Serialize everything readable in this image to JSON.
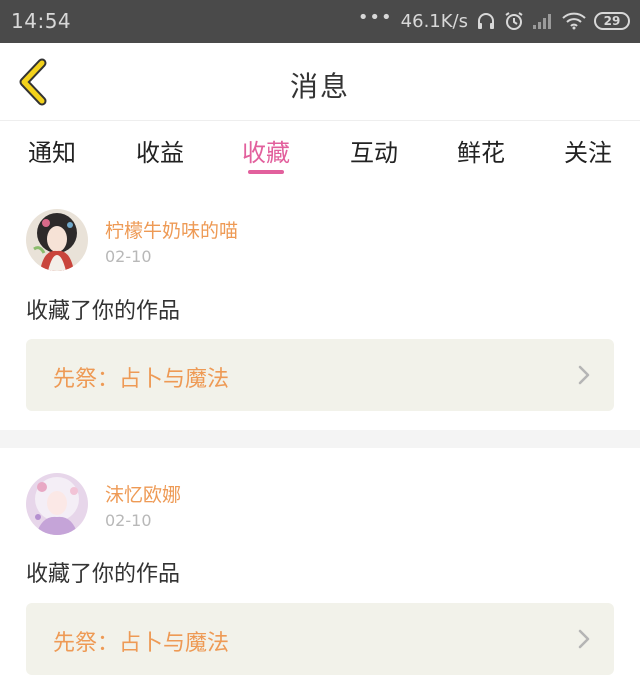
{
  "status_bar": {
    "time": "14:54",
    "dots": "•••",
    "network_speed": "46.1K/s",
    "battery_level": "29",
    "icons": [
      "headphones-icon",
      "alarm-icon",
      "signal-icon",
      "wifi-icon",
      "battery-icon"
    ]
  },
  "header": {
    "title": "消息",
    "back_icon": "chevron-left-icon"
  },
  "tabs": [
    {
      "label": "通知",
      "active": false
    },
    {
      "label": "收益",
      "active": false
    },
    {
      "label": "收藏",
      "active": true
    },
    {
      "label": "互动",
      "active": false
    },
    {
      "label": "鲜花",
      "active": false
    },
    {
      "label": "关注",
      "active": false
    }
  ],
  "messages": [
    {
      "username": "柠檬牛奶味的喵",
      "date": "02-10",
      "action": "收藏了你的作品",
      "work_title": "先祭：占卜与魔法"
    },
    {
      "username": "沫忆欧娜",
      "date": "02-10",
      "action": "收藏了你的作品",
      "work_title": "先祭：占卜与魔法"
    }
  ],
  "colors": {
    "accent_pink": "#e2609d",
    "username_orange": "#ee9a55",
    "back_yellow": "#f3d21c",
    "status_bar_bg": "#4a4a4a",
    "work_card_bg": "#f2f2ea"
  }
}
